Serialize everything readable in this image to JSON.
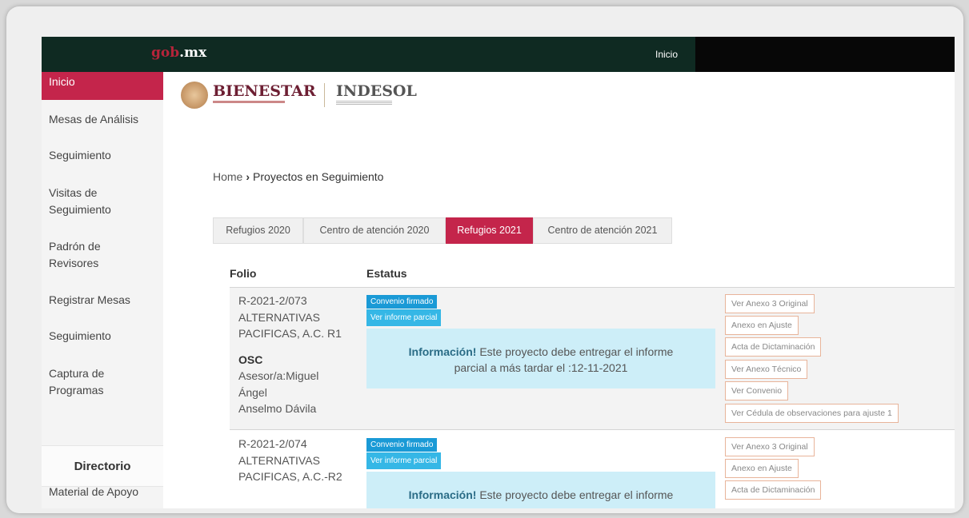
{
  "topbar": {
    "logo_red": "gob",
    "logo_white": ".mx",
    "inicio": "Inicio"
  },
  "sidebar": {
    "items": [
      "Inicio",
      "Mesas de Análisis",
      "Seguimiento",
      "Visitas de Seguimiento",
      "Padrón de Revisores",
      "Registrar Mesas",
      "Seguimiento",
      "Captura de Programas",
      "Directorio",
      "Material de Apoyo"
    ]
  },
  "brand": {
    "bienestar": "BIENESTAR",
    "indesol": "INDESOL"
  },
  "breadcrumb": {
    "home": "Home",
    "separator": "›",
    "current": "Proyectos en Seguimiento"
  },
  "tabs": [
    "Refugios 2020",
    "Centro de atención 2020",
    "Refugios 2021",
    "Centro de atención 2021"
  ],
  "active_tab": "Refugios 2021",
  "table": {
    "columns": [
      "Folio",
      "Estatus"
    ],
    "rows": [
      {
        "folio": "R-2021-2/073",
        "org_line1": "ALTERNATIVAS",
        "org_line2": "PACIFICAS, A.C. R1",
        "osc": "OSC",
        "asesor_line1": "Asesor/a:Miguel",
        "asesor_line2": "Ángel",
        "asesor_line3": "Anselmo Dávila",
        "badge": "Convenio firmado",
        "informe_btn": "Ver informe parcial",
        "info_bold": "Información!",
        "info_line1": "Este proyecto debe entregar el informe",
        "info_line2": "parcial a más tardar el :12-11-2021",
        "actions": [
          "Ver Anexo 3 Original",
          "Anexo en Ajuste",
          "Acta de Dictaminación",
          "Ver Anexo Técnico",
          "Ver Convenio",
          "Ver Cédula de observaciones para ajuste 1"
        ]
      },
      {
        "folio": "R-2021-2/074",
        "org_line1": "ALTERNATIVAS",
        "org_line2": "PACIFICAS, A.C.-R2",
        "badge": "Convenio firmado",
        "informe_btn": "Ver informe parcial",
        "info_bold": "Información!",
        "info_line1": "Este proyecto debe entregar el informe",
        "actions": [
          "Ver Anexo 3 Original",
          "Anexo en Ajuste",
          "Acta de Dictaminación"
        ]
      }
    ]
  }
}
